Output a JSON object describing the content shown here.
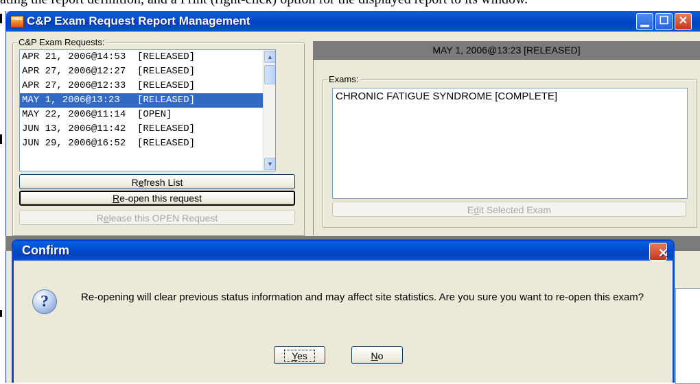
{
  "background_doc": {
    "text": "ating the report definition, and a Print (right-click) option for the displayed report to its window."
  },
  "window": {
    "title": "C&P Exam Request Report Management",
    "app_icon_label": "AMIE",
    "controls": [
      "minimize",
      "maximize",
      "close"
    ]
  },
  "requests": {
    "group_label": "C&P Exam Requests:",
    "items": [
      {
        "text": "APR 21, 2006@14:53  [RELEASED]"
      },
      {
        "text": "APR 27, 2006@12:27  [RELEASED]"
      },
      {
        "text": "APR 27, 2006@12:33  [RELEASED]"
      },
      {
        "text": "MAY 1, 2006@13:23   [RELEASED]",
        "selected": true
      },
      {
        "text": "MAY 22, 2006@11:14  [OPEN]"
      },
      {
        "text": "JUN 13, 2006@11:42  [RELEASED]"
      },
      {
        "text": "JUN 29, 2006@16:52  [RELEASED]"
      }
    ],
    "buttons": {
      "refresh": {
        "pre": "R",
        "u": "e",
        "post": "fresh List"
      },
      "reopen": {
        "pre": "",
        "u": "R",
        "post": "e-open this request"
      },
      "release": {
        "pre": "R",
        "u": "e",
        "post": "lease this OPEN Request"
      }
    }
  },
  "details": {
    "header": "MAY 1, 2006@13:23  [RELEASED]",
    "exams_label": "Exams:",
    "exams": [
      "CHRONIC FATIGUE SYNDROME [COMPLETE]"
    ],
    "edit_button": {
      "pre": "E",
      "u": "d",
      "post": "it Selected Exam"
    }
  },
  "dialog": {
    "title": "Confirm",
    "icon": "question-icon",
    "message": "Re-opening will clear previous status information and may affect site statistics.  Are you sure you want to re-open this exam?",
    "yes": {
      "pre": "",
      "u": "Y",
      "post": "es"
    },
    "no": {
      "pre": "",
      "u": "N",
      "post": "o"
    }
  },
  "colors": {
    "titlebar": "#0243c0",
    "selection": "#316ac5",
    "dialog_close": "#c4371b",
    "panel": "#ece9d8"
  }
}
